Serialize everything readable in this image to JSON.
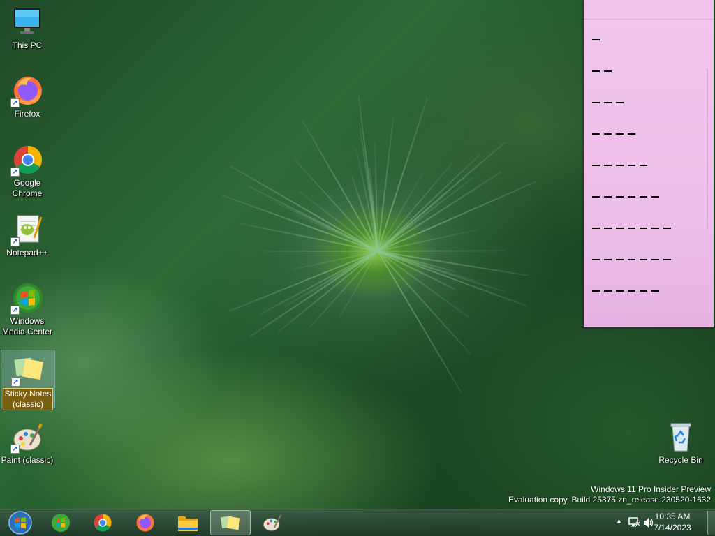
{
  "desktop_icons": [
    {
      "name": "This PC",
      "shortcut": false
    },
    {
      "name": "Firefox",
      "shortcut": true
    },
    {
      "name": "Google Chrome",
      "shortcut": true
    },
    {
      "name": "Notepad++",
      "shortcut": true
    },
    {
      "name": "Windows Media Center",
      "shortcut": true
    },
    {
      "name": "Sticky Notes (classic)",
      "shortcut": true,
      "selected": true,
      "renaming": true
    },
    {
      "name": "Paint (classic)",
      "shortcut": true
    },
    {
      "name": "Recycle Bin",
      "shortcut": false
    }
  ],
  "icon_labels": {
    "this_pc": "This PC",
    "firefox": "Firefox",
    "chrome_1": "Google",
    "chrome_2": "Chrome",
    "notepadpp": "Notepad++",
    "wmc_1": "Windows",
    "wmc_2": "Media Center",
    "sticky_1": "Sticky Notes",
    "sticky_2": "(classic)",
    "paint": "Paint (classic)",
    "recycle": "Recycle Bin"
  },
  "sticky_note": {
    "background": "#ecbde9",
    "dash_counts": [
      1,
      2,
      3,
      4,
      5,
      6,
      7,
      7,
      6
    ]
  },
  "watermark": {
    "line1": "Windows 11 Pro Insider Preview",
    "line2": "Evaluation copy. Build 25375.zn_release.230520-1632"
  },
  "taskbar": {
    "pinned": [
      "start-orb",
      "windows-media-center",
      "google-chrome",
      "firefox",
      "file-explorer",
      "sticky-notes",
      "paint"
    ],
    "active": "sticky-notes"
  },
  "clock": {
    "time": "10:35 AM",
    "date": "7/14/2023"
  },
  "tray": {
    "chevron": "▲",
    "icons": [
      "network-icon",
      "volume-icon"
    ]
  }
}
